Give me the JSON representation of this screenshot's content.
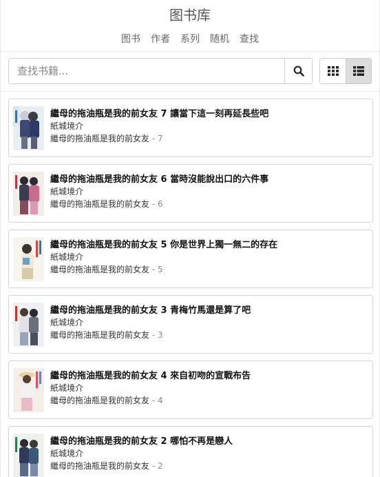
{
  "header": {
    "title": "图书库",
    "nav": [
      "图书",
      "作者",
      "系列",
      "随机",
      "查找"
    ]
  },
  "search": {
    "placeholder": "查找书籍...",
    "value": "",
    "button_icon": "search-icon"
  },
  "view_toggle": {
    "options": [
      {
        "icon": "grid-view-icon",
        "active": false
      },
      {
        "icon": "list-view-icon",
        "active": true
      }
    ]
  },
  "books": [
    {
      "title": "繼母的拖油瓶是我的前女友 7 讓當下這一刻再延長些吧",
      "author": "紙城境介",
      "series": "繼母的拖油瓶是我的前女友",
      "series_sep": " - ",
      "series_index": "7"
    },
    {
      "title": "繼母的拖油瓶是我的前女友 6 當時沒能說出口的六件事",
      "author": "紙城境介",
      "series": "繼母的拖油瓶是我的前女友",
      "series_sep": " - ",
      "series_index": "6"
    },
    {
      "title": "繼母的拖油瓶是我的前女友 5 你是世界上獨一無二的存在",
      "author": "紙城境介",
      "series": "繼母的拖油瓶是我的前女友",
      "series_sep": " - ",
      "series_index": "5"
    },
    {
      "title": "繼母的拖油瓶是我的前女友 3 青梅竹馬還是算了吧",
      "author": "紙城境介",
      "series": "繼母的拖油瓶是我的前女友",
      "series_sep": " - ",
      "series_index": "3"
    },
    {
      "title": "繼母的拖油瓶是我的前女友 4 來自初吻的宣戰布告",
      "author": "紙城境介",
      "series": "繼母的拖油瓶是我的前女友",
      "series_sep": " - ",
      "series_index": "4"
    },
    {
      "title": "繼母的拖油瓶是我的前女友 2 哪怕不再是戀人",
      "author": "紙城境介",
      "series": "繼母的拖油瓶是我的前女友",
      "series_sep": " - ",
      "series_index": "2"
    }
  ],
  "colors": {
    "border": "#d5d5d5",
    "active_toggle": "#dcdcdc",
    "series_index": "#888888"
  }
}
